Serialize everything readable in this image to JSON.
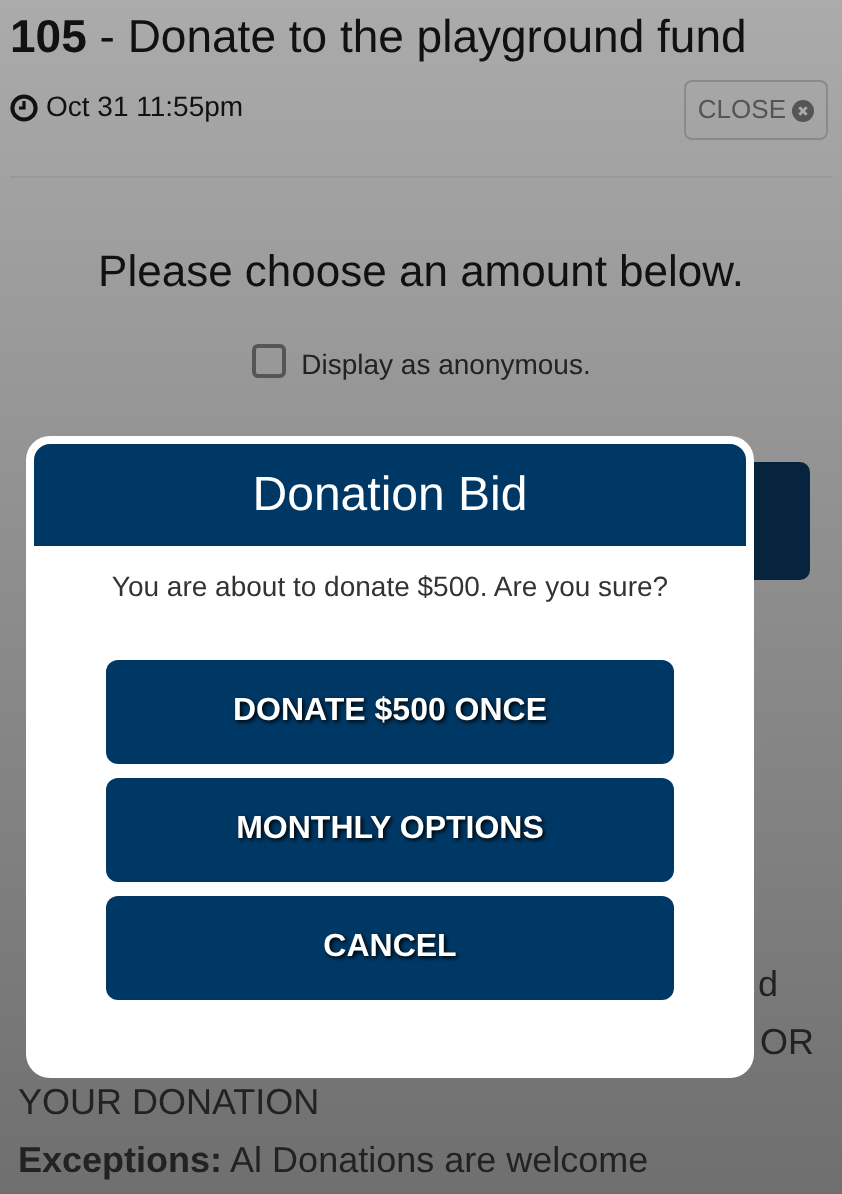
{
  "item": {
    "number": "105",
    "title": "- Donate to the playground fund",
    "time": "Oct 31 11:55pm",
    "close_button": "CLOSE"
  },
  "prompt": "Please choose an amount below.",
  "anonymous": {
    "label": "Display as anonymous.",
    "checked": false
  },
  "details_fragments": [
    "d",
    "OR"
  ],
  "details_tail": "YOUR DONATION",
  "exceptions": {
    "label": "Exceptions:",
    "text": "Al Donations are welcome"
  },
  "dialog": {
    "title": "Donation Bid",
    "message": "You are about to donate $500. Are you sure?",
    "buttons": [
      "DONATE $500 ONCE",
      "MONTHLY OPTIONS",
      "CANCEL"
    ]
  }
}
